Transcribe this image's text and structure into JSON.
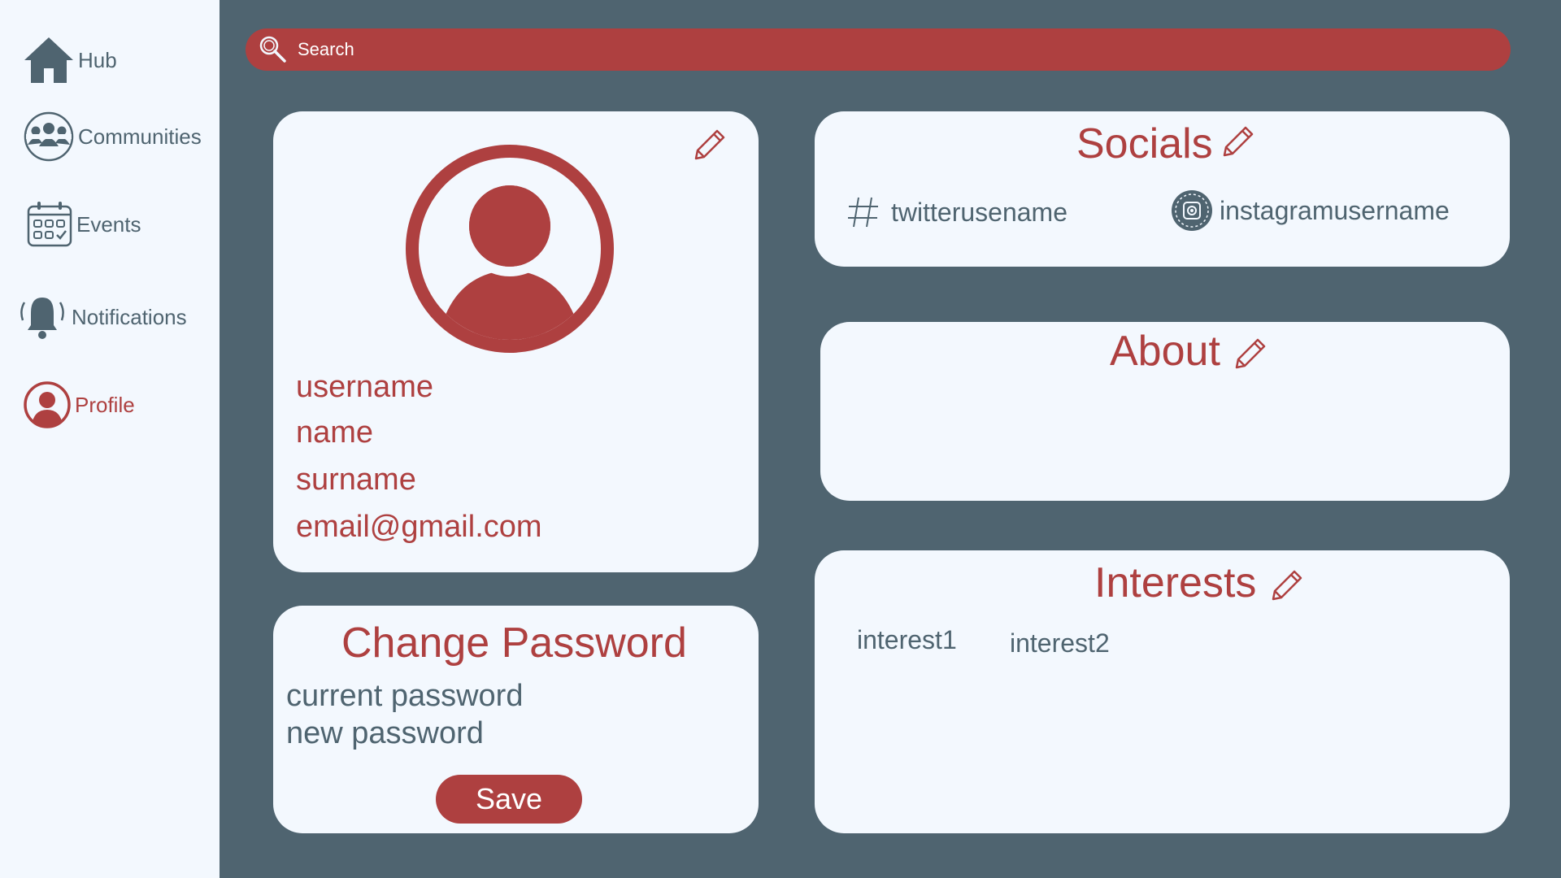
{
  "colors": {
    "accent": "#ae4040",
    "slate": "#4f6470",
    "panel": "#f3f8fe"
  },
  "sidebar": {
    "items": [
      {
        "label": "Hub",
        "icon": "home-icon"
      },
      {
        "label": "Communities",
        "icon": "people-icon"
      },
      {
        "label": "Events",
        "icon": "calendar-icon"
      },
      {
        "label": "Notifications",
        "icon": "bell-icon"
      },
      {
        "label": "Profile",
        "icon": "user-icon",
        "active": true
      }
    ]
  },
  "search": {
    "placeholder": "Search"
  },
  "profile": {
    "username": "username",
    "name": "name",
    "surname": "surname",
    "email": "email@gmail.com"
  },
  "change_password": {
    "title": "Change Password",
    "current_placeholder": "current password",
    "new_placeholder": "new password",
    "save_label": "Save"
  },
  "socials": {
    "title": "Socials",
    "twitter": "twitterusename",
    "instagram": "instagramusername"
  },
  "about": {
    "title": "About"
  },
  "interests": {
    "title": "Interests",
    "items": [
      "interest1",
      "interest2"
    ]
  }
}
